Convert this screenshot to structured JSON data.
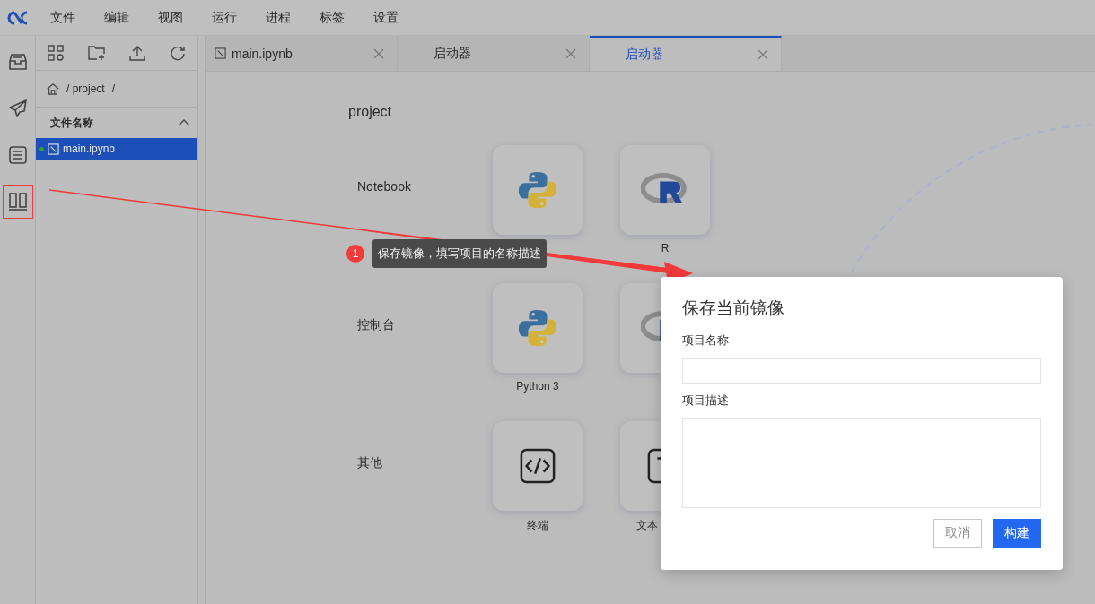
{
  "menu_bar": {
    "items": [
      "文件",
      "编辑",
      "视图",
      "运行",
      "进程",
      "标签",
      "设置"
    ]
  },
  "activity_bar": {
    "items": [
      {
        "kind": "inbox",
        "annotated": false
      },
      {
        "kind": "send",
        "annotated": false
      },
      {
        "kind": "list",
        "annotated": false
      },
      {
        "kind": "columns",
        "annotated": true
      }
    ]
  },
  "file_browser": {
    "breadcrumb": [
      "/ project",
      "/"
    ],
    "column_header": "文件名称",
    "files": [
      {
        "name": "main.ipynb",
        "selected": true,
        "running": true
      }
    ]
  },
  "tabs": [
    {
      "label": "main.ipynb",
      "kind": "notebook",
      "selected": false
    },
    {
      "label": "启动器",
      "kind": "launcher",
      "selected": false
    },
    {
      "label": "启动器",
      "kind": "launcher",
      "selected": true
    }
  ],
  "launcher": {
    "title": "project",
    "sections": [
      {
        "label": "Notebook",
        "cards": [
          {
            "kind": "python"
          },
          {
            "kind": "r",
            "label": "R"
          }
        ]
      },
      {
        "label": "控制台",
        "cards": [
          {
            "kind": "python",
            "label": "Python 3"
          },
          {
            "kind": "r"
          }
        ]
      },
      {
        "label": "其他",
        "cards": [
          {
            "kind": "terminal",
            "label": "终端"
          },
          {
            "kind": "text",
            "label": "文本"
          }
        ]
      }
    ]
  },
  "annotation": {
    "badge": "1",
    "tooltip": "保存镜像，填写项目的名称描述"
  },
  "dialog": {
    "title": "保存当前镜像",
    "fields": [
      {
        "label": "项目名称",
        "kind": "input"
      },
      {
        "label": "项目描述",
        "kind": "textarea"
      }
    ],
    "buttons": [
      {
        "label": "取消",
        "kind": "secondary"
      },
      {
        "label": "构建",
        "kind": "primary"
      }
    ]
  }
}
